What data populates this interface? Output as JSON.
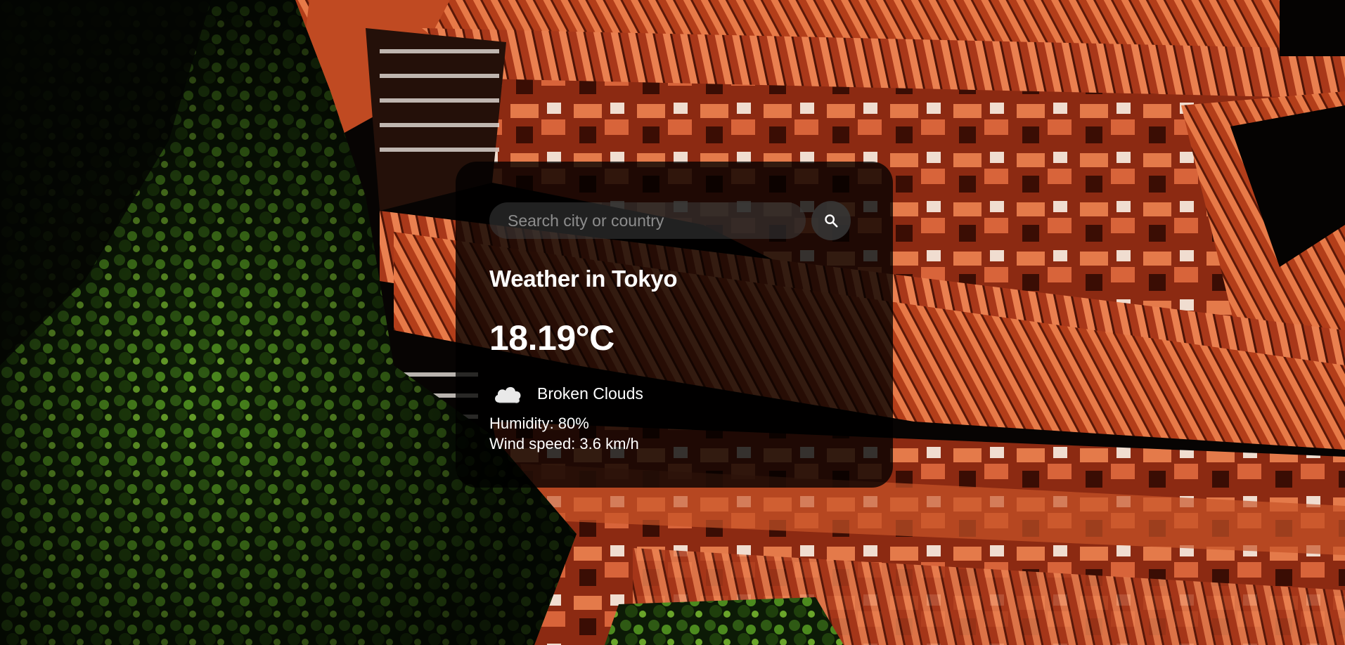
{
  "search": {
    "placeholder": "Search city or country",
    "value": "",
    "button_icon": "search-icon"
  },
  "weather": {
    "title": "Weather in Tokyo",
    "temperature": "18.19°C",
    "condition_icon": "cloud-icon",
    "condition": "Broken Clouds",
    "humidity": "Humidity: 80%",
    "wind": "Wind speed: 3.6 km/h"
  },
  "colors": {
    "card_background": "#000000",
    "text": "#ffffff",
    "input_background": "#3c3c3c",
    "temple_red": "#c94a24"
  },
  "background": {
    "subject": "background-photo"
  }
}
